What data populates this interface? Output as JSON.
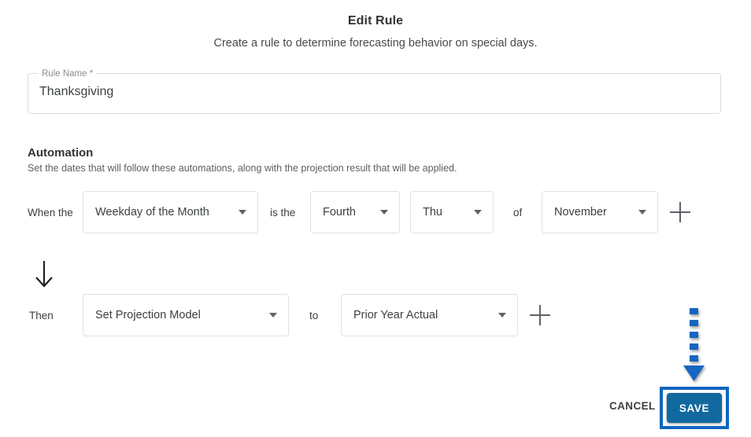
{
  "dialog": {
    "title": "Edit Rule",
    "subtitle": "Create a rule to determine forecasting behavior on special days."
  },
  "rule_name": {
    "label": "Rule Name *",
    "value": "Thanksgiving",
    "placeholder": "Rule Name"
  },
  "automation": {
    "title": "Automation",
    "description": "Set the dates that will follow these automations, along with the projection result that will be applied.",
    "when_row": {
      "prefix_label": "When the",
      "type_select": "Weekday of the Month",
      "middle_label": "is the",
      "ordinal_select": "Fourth",
      "weekday_select": "Thu",
      "of_label": "of",
      "month_select": "November",
      "add_label": "+"
    },
    "then_row": {
      "prefix_label": "Then",
      "action_select": "Set Projection Model",
      "to_label": "to",
      "value_select": "Prior Year Actual",
      "add_label": "+"
    }
  },
  "footer": {
    "cancel_label": "CANCEL",
    "save_label": "SAVE"
  },
  "colors": {
    "save_button_fill": "#11699f",
    "highlight_border": "#0d66c2",
    "pointer_arrow": "#1565c0",
    "field_border": "#dfe1e5",
    "text_primary": "#3c4043",
    "text_muted": "#8a8d91"
  }
}
